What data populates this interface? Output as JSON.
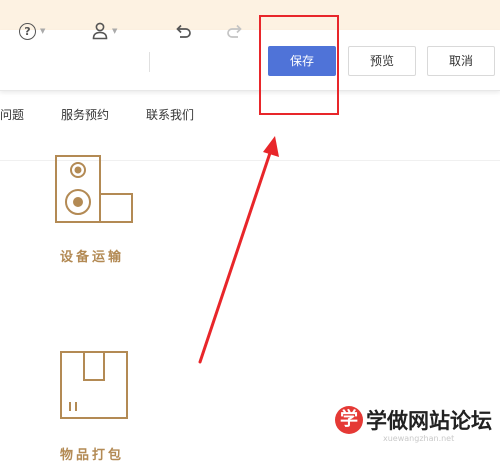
{
  "toolbar": {
    "help_icon": "question-circle-icon",
    "user_icon": "user-icon",
    "undo_icon": "undo-icon",
    "redo_icon": "redo-icon",
    "save_label": "保存",
    "preview_label": "预览",
    "cancel_label": "取消"
  },
  "nav": {
    "items": [
      "问题",
      "服务预约",
      "联系我们"
    ]
  },
  "services": [
    {
      "label": "设备运输",
      "icon": "speaker-device-icon"
    },
    {
      "label": "物品打包",
      "icon": "package-box-icon"
    }
  ],
  "annotation": {
    "highlight_color": "#e8262a",
    "arrow_color": "#e8262a"
  },
  "watermark": {
    "badge": "学",
    "text": "学做网站论坛",
    "url": "xuewangzhan.net"
  },
  "colors": {
    "primary": "#4f73d8",
    "accent": "#b38a54",
    "banner": "#fdf2e2"
  }
}
